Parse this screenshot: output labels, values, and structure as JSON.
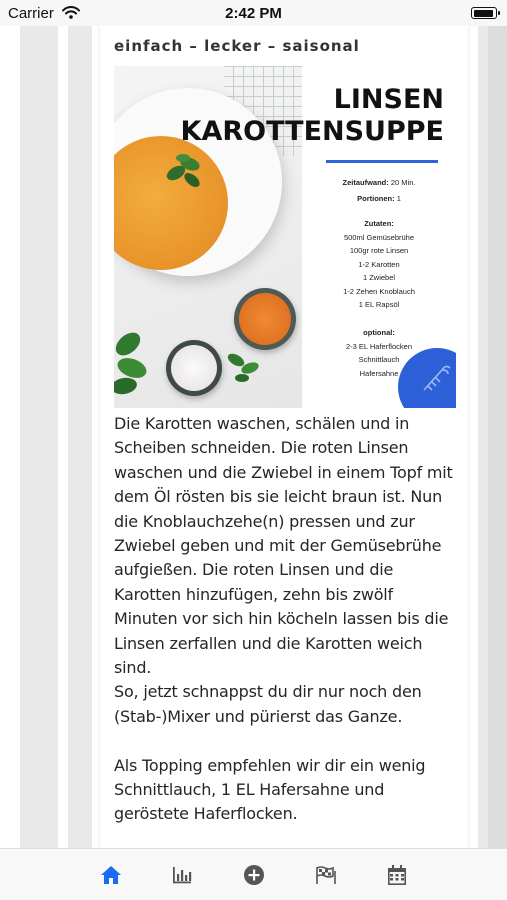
{
  "status_bar": {
    "carrier": "Carrier",
    "time": "2:42 PM",
    "battery_level": 0.95
  },
  "recipe": {
    "subtitle": "einfach – lecker – saisonal",
    "image": {
      "title_line1": "LINSEN",
      "title_line2": "KAROTTENSUPPE",
      "accent_color": "#2f62d6",
      "time_label": "Zeitaufwand:",
      "time_value": "20 Min.",
      "portions_label": "Portionen:",
      "portions_value": "1",
      "ingredients_heading": "Zutaten:",
      "ingredients": [
        "500ml Gemüsebrühe",
        "100gr rote Linsen",
        "1-2 Karotten",
        "1 Zwiebel",
        "1-2 Zehen Knoblauch",
        "1 EL Rapsöl"
      ],
      "optional_heading": "optional:",
      "optional": [
        "2-3 EL Haferflocken",
        "Schnittlauch",
        "Hafersahne"
      ]
    },
    "instructions": "Die Karotten waschen, schälen und in Scheiben schneiden. Die roten Linsen waschen und die Zwiebel in einem Topf mit dem Öl rösten bis sie leicht braun ist. Nun die Knoblauchzehe(n) pressen und zur Zwiebel geben und mit der Gemüsebrühe aufgießen. Die roten Linsen und die Karotten hinzufügen, zehn bis zwölf Minuten vor sich hin köcheln lassen bis die Linsen zerfallen und die Karotten weich sind.",
    "instructions_2": "So, jetzt schnappst du dir nur noch den (Stab-)Mixer und pürierst das Ganze.",
    "topping": "Als Topping empfehlen wir dir ein wenig Schnittlauch, 1 EL Hafersahne und geröstete Haferflocken."
  },
  "tab_bar": {
    "active_color": "#1a6cf0",
    "inactive_color": "#555555",
    "items": [
      {
        "icon": "home-icon",
        "active": true
      },
      {
        "icon": "bar-chart-icon",
        "active": false
      },
      {
        "icon": "plus-circle-icon",
        "active": false
      },
      {
        "icon": "flags-icon",
        "active": false
      },
      {
        "icon": "calendar-icon",
        "active": false
      }
    ]
  }
}
